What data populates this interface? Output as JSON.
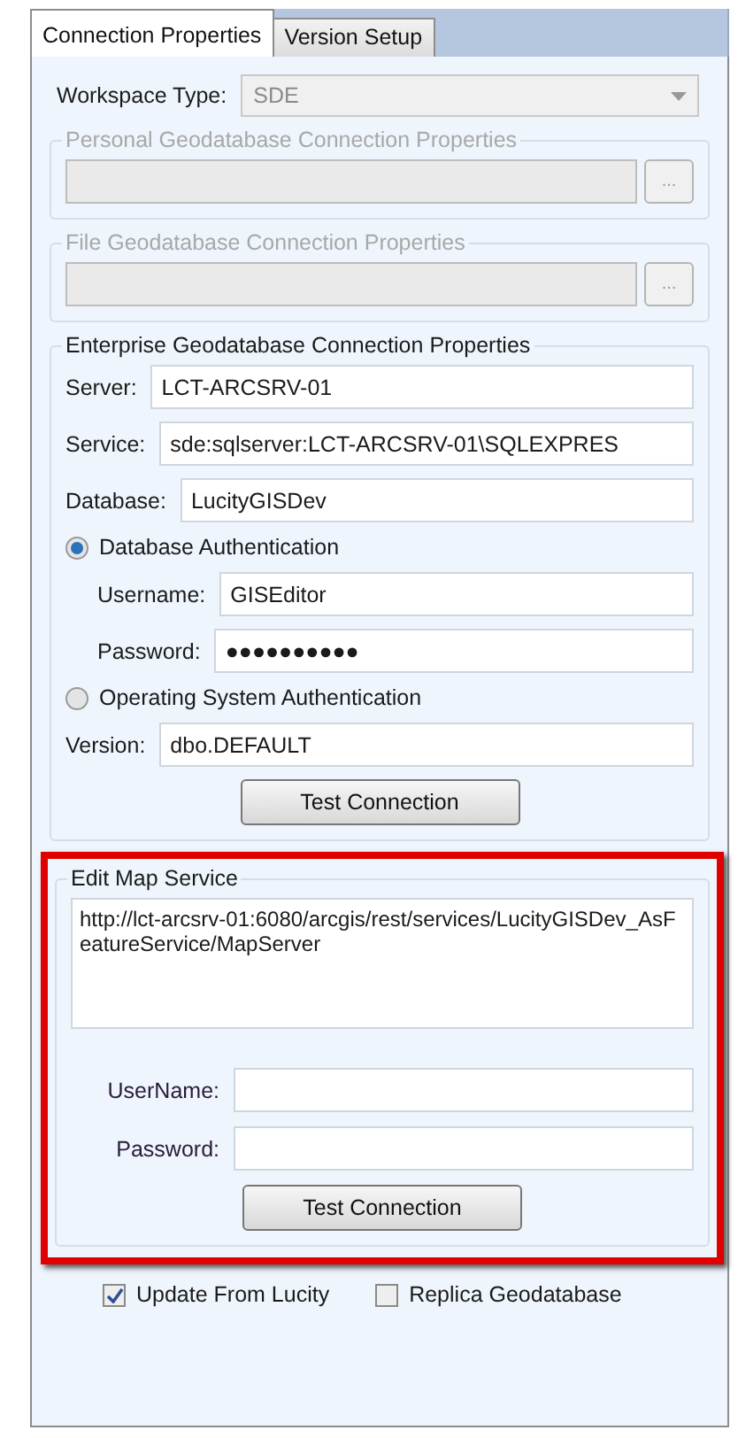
{
  "tabs": [
    {
      "label": "Connection Properties",
      "selected": true
    },
    {
      "label": "Version Setup",
      "selected": false
    }
  ],
  "workspace_type": {
    "label": "Workspace Type:",
    "value": "SDE",
    "disabled": true
  },
  "file_groups": [
    {
      "title": "Personal Geodatabase Connection Properties",
      "browse": "...",
      "disabled": true
    },
    {
      "title": "File Geodatabase Connection Properties",
      "browse": "...",
      "disabled": true
    }
  ],
  "enterprise": {
    "title": "Enterprise Geodatabase Connection Properties",
    "fields": [
      {
        "label": "Server:",
        "value": "LCT-ARCSRV-01"
      },
      {
        "label": "Service:",
        "value": "sde:sqlserver:LCT-ARCSRV-01\\SQLEXPRES"
      },
      {
        "label": "Database:",
        "value": "LucityGISDev"
      }
    ],
    "auth_db": {
      "label": "Database Authentication",
      "selected": true
    },
    "auth_fields": [
      {
        "label": "Username:",
        "value": "GISEditor"
      },
      {
        "label": "Password:",
        "value": "●●●●●●●●●●"
      }
    ],
    "auth_os": {
      "label": "Operating System Authentication",
      "selected": false
    },
    "version": {
      "label": "Version:",
      "value": "dbo.DEFAULT"
    },
    "button": "Test Connection"
  },
  "map_service": {
    "title": "Edit Map Service",
    "url": "http://lct-arcsrv-01:6080/arcgis/rest/services/LucityGISDev_AsFeatureService/MapServer",
    "fields": [
      {
        "label": "UserName:"
      },
      {
        "label": "Password:"
      }
    ],
    "button": "Test Connection"
  },
  "options": [
    {
      "label": "Update From Lucity",
      "checked": true
    },
    {
      "label": "Replica Geodatabase",
      "checked": false
    }
  ]
}
